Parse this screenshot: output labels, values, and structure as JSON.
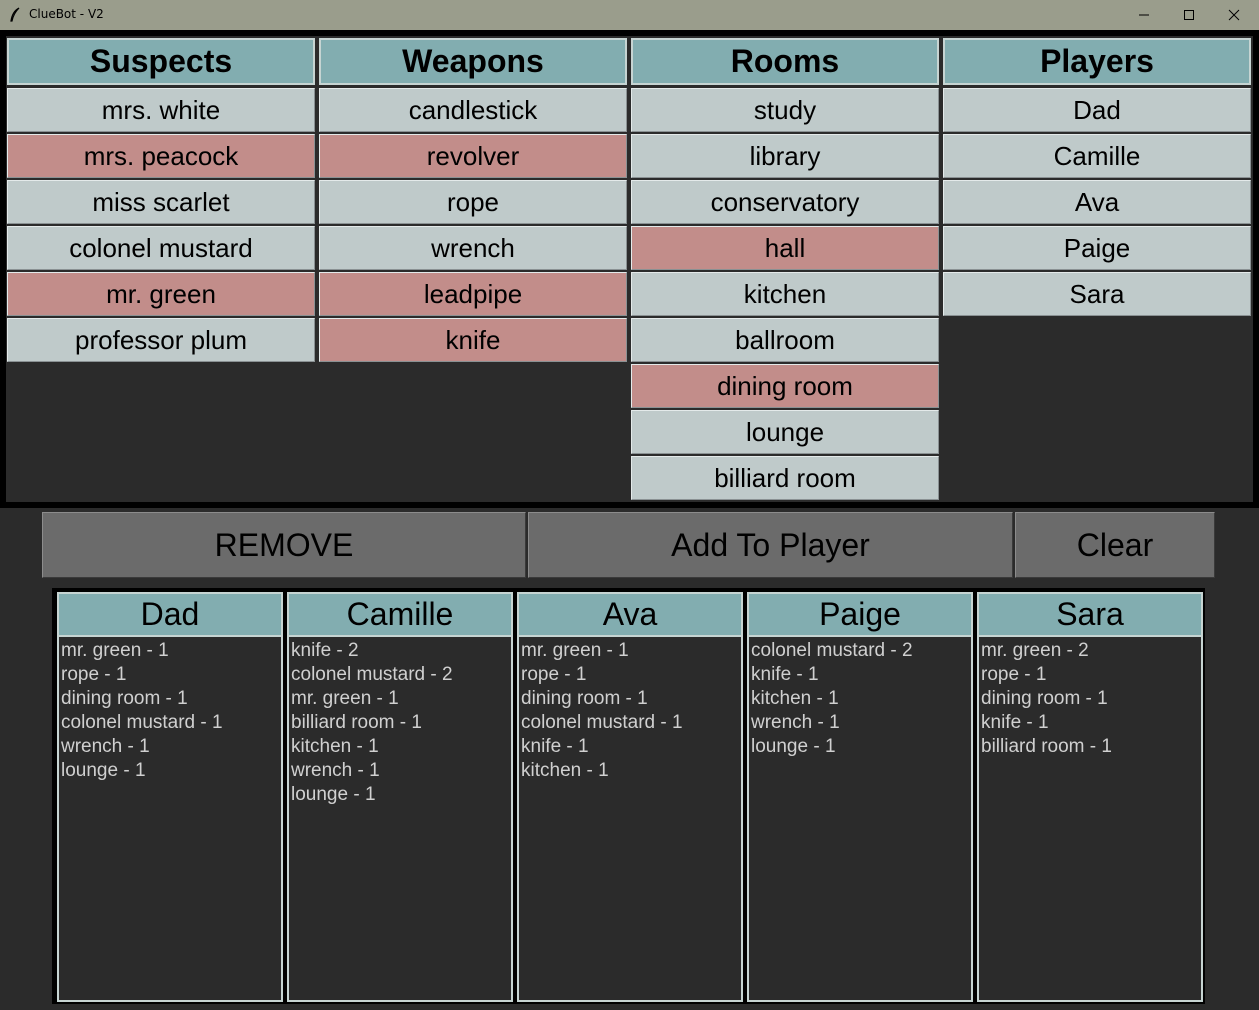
{
  "window": {
    "title": "ClueBot - V2"
  },
  "categories": {
    "suspects": {
      "header": "Suspects",
      "items": [
        {
          "label": "mrs. white",
          "marked": false
        },
        {
          "label": "mrs. peacock",
          "marked": true
        },
        {
          "label": "miss scarlet",
          "marked": false
        },
        {
          "label": "colonel mustard",
          "marked": false
        },
        {
          "label": "mr. green",
          "marked": true
        },
        {
          "label": "professor plum",
          "marked": false
        }
      ]
    },
    "weapons": {
      "header": "Weapons",
      "items": [
        {
          "label": "candlestick",
          "marked": false
        },
        {
          "label": "revolver",
          "marked": true
        },
        {
          "label": "rope",
          "marked": false
        },
        {
          "label": "wrench",
          "marked": false
        },
        {
          "label": "leadpipe",
          "marked": true
        },
        {
          "label": "knife",
          "marked": true
        }
      ]
    },
    "rooms": {
      "header": "Rooms",
      "items": [
        {
          "label": "study",
          "marked": false
        },
        {
          "label": "library",
          "marked": false
        },
        {
          "label": "conservatory",
          "marked": false
        },
        {
          "label": "hall",
          "marked": true
        },
        {
          "label": "kitchen",
          "marked": false
        },
        {
          "label": "ballroom",
          "marked": false
        },
        {
          "label": "dining room",
          "marked": true
        },
        {
          "label": "lounge",
          "marked": false
        },
        {
          "label": "billiard room",
          "marked": false
        }
      ]
    },
    "players": {
      "header": "Players",
      "items": [
        {
          "label": "Dad",
          "marked": false
        },
        {
          "label": "Camille",
          "marked": false
        },
        {
          "label": "Ava",
          "marked": false
        },
        {
          "label": "Paige",
          "marked": false
        },
        {
          "label": "Sara",
          "marked": false
        }
      ]
    }
  },
  "actions": {
    "remove": "REMOVE",
    "add_to_player": "Add To Player",
    "clear": "Clear"
  },
  "player_cards": [
    {
      "name": "Dad",
      "lines": [
        "mr. green - 1",
        "rope - 1",
        "dining room - 1",
        "colonel mustard - 1",
        "wrench - 1",
        "lounge - 1"
      ]
    },
    {
      "name": "Camille",
      "lines": [
        "knife - 2",
        "colonel mustard - 2",
        "mr. green - 1",
        "billiard room - 1",
        "kitchen - 1",
        "wrench - 1",
        "lounge - 1"
      ]
    },
    {
      "name": "Ava",
      "lines": [
        "mr. green - 1",
        "rope - 1",
        "dining room - 1",
        "colonel mustard - 1",
        "knife - 1",
        "kitchen - 1"
      ]
    },
    {
      "name": "Paige",
      "lines": [
        "colonel mustard - 2",
        "knife - 1",
        "kitchen - 1",
        "wrench - 1",
        "lounge - 1"
      ]
    },
    {
      "name": "Sara",
      "lines": [
        "mr. green - 2",
        "rope - 1",
        "dining room - 1",
        "knife - 1",
        "billiard room - 1"
      ]
    }
  ],
  "colors": {
    "header_teal": "#82adb0",
    "item_plain": "#bfcaca",
    "item_marked": "#c28d8a",
    "background": "#2b2b2b",
    "button_gray": "#6b6b6b"
  }
}
